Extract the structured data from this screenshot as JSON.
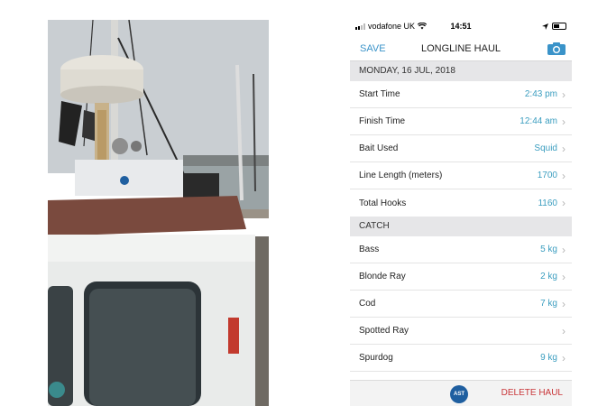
{
  "status_bar": {
    "carrier": "vodafone UK",
    "time": "14:51"
  },
  "nav": {
    "save_label": "SAVE",
    "title": "LONGLINE HAUL",
    "camera_icon": "camera-icon"
  },
  "date_header": "MONDAY, 16 JUL, 2018",
  "haul_rows": [
    {
      "label": "Start Time",
      "value": "2:43 pm"
    },
    {
      "label": "Finish Time",
      "value": "12:44 am"
    },
    {
      "label": "Bait Used",
      "value": "Squid"
    },
    {
      "label": "Line Length (meters)",
      "value": "1700"
    },
    {
      "label": "Total Hooks",
      "value": "1160"
    }
  ],
  "catch_header": "CATCH",
  "catch_rows": [
    {
      "label": "Bass",
      "value": "5 kg"
    },
    {
      "label": "Blonde Ray",
      "value": "2 kg"
    },
    {
      "label": "Cod",
      "value": "7 kg"
    },
    {
      "label": "Spotted Ray",
      "value": ""
    },
    {
      "label": "Spurdog",
      "value": "9 kg"
    }
  ],
  "footer": {
    "logo_text": "AST",
    "delete_label": "DELETE HAUL"
  },
  "colors": {
    "accent": "#3a93c9",
    "value_text": "#3a9dbf",
    "delete": "#c9373a",
    "section_bg": "#e6e6e8"
  }
}
